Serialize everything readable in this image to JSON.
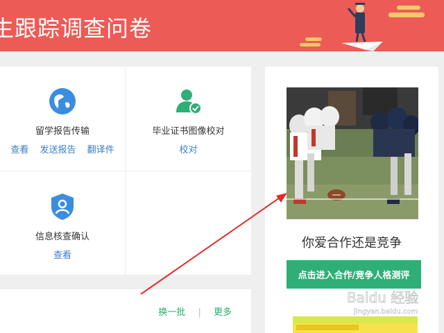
{
  "banner": {
    "title": "生跟踪调查问卷"
  },
  "services": [
    {
      "label": "留学报告传输",
      "links": [
        "查看",
        "发送报告",
        "翻译件"
      ],
      "icon": "globe-icon"
    },
    {
      "label": "毕业证书图像校对",
      "links": [
        "校对"
      ],
      "icon": "user-check-icon"
    },
    {
      "label": "信息核查确认",
      "links": [
        "查看"
      ],
      "icon": "shield-user-icon"
    }
  ],
  "bottom": {
    "refresh_label": "换一批",
    "separator": "|",
    "more_label": "更多"
  },
  "ad": {
    "title": "你爱合作还是竞争",
    "button_label": "点击进入合作/竞争人格测评"
  },
  "watermark": {
    "text": "Baidu 经验",
    "url": "jingyan.baidu.com"
  },
  "colors": {
    "banner": "#ec5b55",
    "link": "#3b7fc4",
    "green": "#25ad6c",
    "button": "#2fae77",
    "icon_blue": "#3b8de0",
    "icon_green": "#2fae77"
  }
}
